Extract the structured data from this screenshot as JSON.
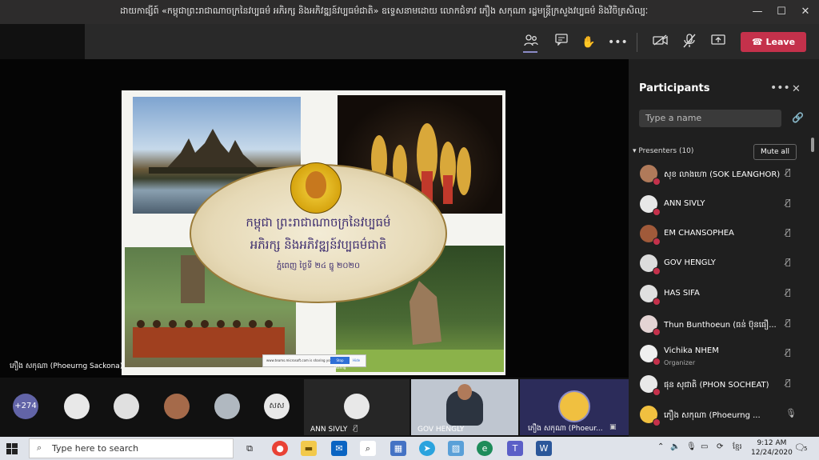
{
  "window": {
    "title": "ដាយកាផ្សីព៍ «កម្ពុជាព្រះរាជាណាចក្រនៃវប្បធម៌ អភិរក្ស និងអភិវឌ្ឍន៍វប្បធម៌ជាតិ» ឧទ្ទេសនាមដោយ លោកជំទាវ ភឿង សកុណា រដ្ឋមន្ត្រីក្រសួងវប្បធម៌ និងវិចិត្រសិល្បៈ"
  },
  "toolbar": {
    "leave_label": "Leave",
    "icons": [
      "participants-icon",
      "chat-icon",
      "raise-hand-icon",
      "more-icon",
      "camera-off-icon",
      "mic-off-icon",
      "share-icon",
      "phone-icon"
    ]
  },
  "slide": {
    "title_line1": "កម្ពុជា ព្រះរាជាណាចក្រនៃវប្បធម៌",
    "title_line2": "អភិរក្ស និងអភិវឌ្ឍន៍វប្បធម៌ជាតិ",
    "title_line3": "ភ្នំពេញ ថ្ងៃទី ២៤ ធ្នូ ២០២០",
    "sharing_bar_text": "www.teams.microsoft.com is sharing your screen.",
    "sharing_stop": "Stop sharing",
    "sharing_hide": "Hide"
  },
  "stage": {
    "speaker_label": "ភឿង សកុណា (Phoeurng Sackona)"
  },
  "participants": {
    "title": "Participants",
    "search_placeholder": "Type a name",
    "presenters_label": "Presenters (10)",
    "mute_all_label": "Mute all",
    "list": [
      {
        "name": "សុខ លាងហោ (SOK LEANGHOR)",
        "role": ""
      },
      {
        "name": "ANN SIVLY",
        "role": ""
      },
      {
        "name": "EM CHANSOPHEA",
        "role": ""
      },
      {
        "name": "GOV HENGLY",
        "role": ""
      },
      {
        "name": "HAS SIFA",
        "role": ""
      },
      {
        "name": "Thun Bunthoeun (ធន់ ប៊ុនធឿ...",
        "role": ""
      },
      {
        "name": "Vichika NHEM",
        "role": "Organizer"
      },
      {
        "name": "ផុន សុជាតិ (PHON SOCHEAT)",
        "role": ""
      },
      {
        "name": "ភឿង សកុណា (Phoeurng ...",
        "role": ""
      }
    ]
  },
  "strip": {
    "overflow_count": "+274",
    "initials_avatar": "សស",
    "tiles": [
      {
        "label": "ANN SIVLY"
      },
      {
        "label": "GOV HENGLY"
      },
      {
        "label": "ភឿង សកុណា (Phoeur..."
      }
    ]
  },
  "taskbar": {
    "search_placeholder": "Type here to search",
    "time": "9:12 AM",
    "date": "12/24/2020",
    "lang": "ខ្មែរ",
    "notif_count": "5"
  }
}
